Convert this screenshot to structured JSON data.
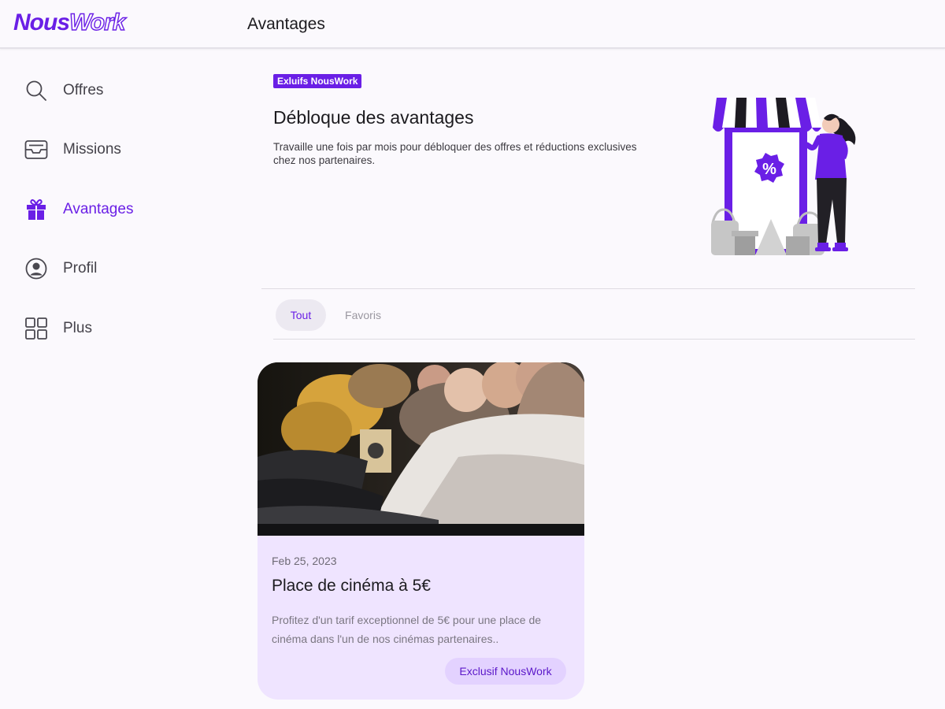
{
  "app": {
    "brand_part1": "Nous",
    "brand_part2": "Work",
    "page_title": "Avantages",
    "accent_color": "#6a1fe6"
  },
  "sidebar": {
    "items": [
      {
        "label": "Offres",
        "icon": "search-icon",
        "active": false
      },
      {
        "label": "Missions",
        "icon": "inbox-icon",
        "active": false
      },
      {
        "label": "Avantages",
        "icon": "gift-icon",
        "active": true
      },
      {
        "label": "Profil",
        "icon": "user-circle-icon",
        "active": false
      },
      {
        "label": "Plus",
        "icon": "grid-icon",
        "active": false
      }
    ]
  },
  "hero": {
    "badge": "Exluifs NousWork",
    "title": "Débloque des avantages",
    "description": "Travaille une fois par mois pour débloquer des offres et réductions exclusives chez nos partenaires.",
    "illustration_sign": "%"
  },
  "tabs": [
    {
      "label": "Tout",
      "active": true
    },
    {
      "label": "Favoris",
      "active": false
    }
  ],
  "offers": [
    {
      "date": "Feb 25, 2023",
      "title": "Place de cinéma à 5€",
      "description": "Profitez d'un tarif exceptionnel de 5€ pour une place de cinéma dans l'un de nos cinémas partenaires..",
      "tag": "Exclusif NousWork",
      "image": "cinema-audience-photo"
    }
  ]
}
